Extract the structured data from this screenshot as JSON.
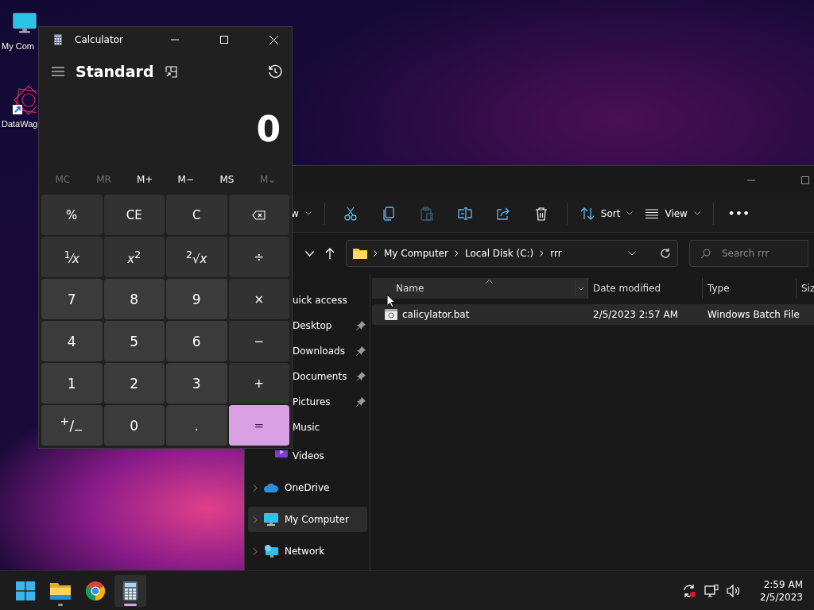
{
  "desktop_icons": [
    {
      "kind": "monitor",
      "label": "My Com"
    },
    {
      "kind": "shortcut",
      "label": "DataWag"
    }
  ],
  "calculator": {
    "title": "Calculator",
    "mode": "Standard",
    "display": "0",
    "memory": [
      {
        "label": "MC",
        "disabled": true
      },
      {
        "label": "MR",
        "disabled": true
      },
      {
        "label": "M+",
        "disabled": false
      },
      {
        "label": "M−",
        "disabled": false
      },
      {
        "label": "MS",
        "disabled": false
      },
      {
        "label": "M⌄",
        "disabled": true
      }
    ],
    "keys": [
      {
        "kind": "op",
        "label": "%"
      },
      {
        "kind": "op",
        "label": "CE"
      },
      {
        "kind": "op",
        "label": "C"
      },
      {
        "kind": "backspace"
      },
      {
        "kind": "op",
        "label": "$^{1}$⁄*x*"
      },
      {
        "kind": "op",
        "label": "*x*$^{2}$"
      },
      {
        "kind": "op",
        "label": "$^{2}$√*x*"
      },
      {
        "kind": "op",
        "label": "÷"
      },
      {
        "kind": "num",
        "label": "7"
      },
      {
        "kind": "num",
        "label": "8"
      },
      {
        "kind": "num",
        "label": "9"
      },
      {
        "kind": "op",
        "label": "×"
      },
      {
        "kind": "num",
        "label": "4"
      },
      {
        "kind": "num",
        "label": "5"
      },
      {
        "kind": "num",
        "label": "6"
      },
      {
        "kind": "op",
        "label": "−"
      },
      {
        "kind": "num",
        "label": "1"
      },
      {
        "kind": "num",
        "label": "2"
      },
      {
        "kind": "num",
        "label": "3"
      },
      {
        "kind": "op",
        "label": "+"
      },
      {
        "kind": "num",
        "label": "$^{+}$/$_{−}$"
      },
      {
        "kind": "num",
        "label": "0"
      },
      {
        "kind": "num",
        "label": "."
      },
      {
        "kind": "equals",
        "label": "="
      }
    ]
  },
  "explorer": {
    "toolbar": [
      {
        "kind": "new",
        "label": "w"
      },
      {
        "kind": "divider"
      },
      {
        "kind": "cut"
      },
      {
        "kind": "copy"
      },
      {
        "kind": "paste",
        "disabled": true
      },
      {
        "kind": "rename"
      },
      {
        "kind": "share"
      },
      {
        "kind": "delete"
      },
      {
        "kind": "divider"
      },
      {
        "kind": "sort",
        "label": "Sort"
      },
      {
        "kind": "view",
        "label": "View"
      },
      {
        "kind": "divider"
      },
      {
        "kind": "more",
        "label": "•••"
      }
    ],
    "breadcrumbs": [
      "My Computer",
      "Local Disk (C:)",
      "rrr"
    ],
    "search": {
      "placeholder": "Search rrr"
    },
    "nav": [
      {
        "label": "uick access",
        "kind": "group",
        "selected": false
      },
      {
        "label": "Desktop",
        "kind": "pinned",
        "selected": false
      },
      {
        "label": "Downloads",
        "kind": "pinned",
        "selected": false
      },
      {
        "label": "Documents",
        "kind": "pinned",
        "selected": false
      },
      {
        "label": "Pictures",
        "kind": "pinned",
        "selected": false
      },
      {
        "label": "Music",
        "kind": "plain",
        "selected": false
      },
      {
        "label": "Videos",
        "kind": "videos",
        "selected": false
      },
      {
        "label": "OneDrive",
        "kind": "onedrive",
        "selected": false
      },
      {
        "label": "My Computer",
        "kind": "computer",
        "selected": true
      },
      {
        "label": "Network",
        "kind": "network",
        "selected": false
      }
    ],
    "columns": [
      {
        "label": "Name",
        "selected": true
      },
      {
        "label": "Date modified",
        "selected": false
      },
      {
        "label": "Type",
        "selected": false
      },
      {
        "label": "Siz",
        "selected": false
      }
    ],
    "files": [
      {
        "name": "calicylator.bat",
        "date": "2/5/2023 2:57 AM",
        "type": "Windows Batch File",
        "selected": true
      }
    ]
  },
  "taskbar": {
    "apps": [
      {
        "kind": "start",
        "running": false,
        "active": false
      },
      {
        "kind": "folder",
        "running": true,
        "active": false
      },
      {
        "kind": "chrome",
        "running": false,
        "active": false
      },
      {
        "kind": "calculator",
        "running": true,
        "active": true
      }
    ],
    "time": "2:59 AM",
    "date": "2/5/2023"
  }
}
